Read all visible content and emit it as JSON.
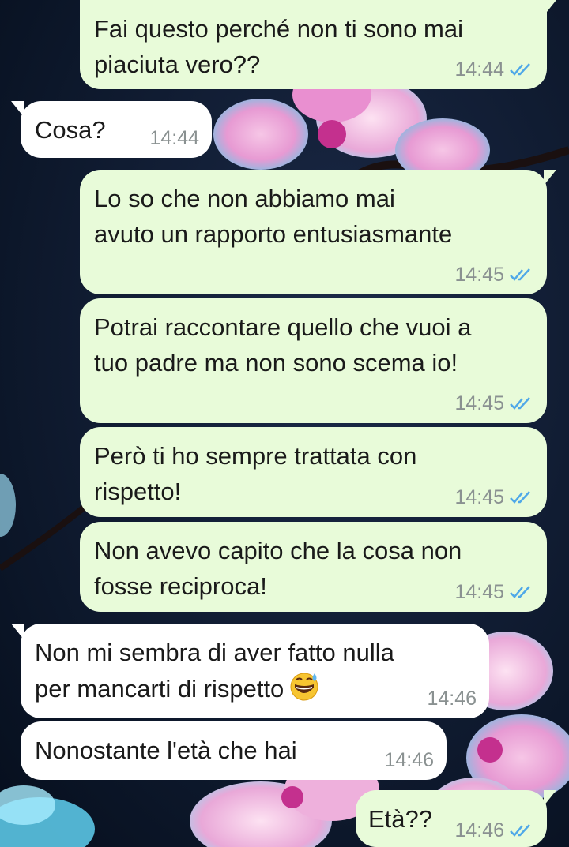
{
  "chat": {
    "messages": [
      {
        "dir": "out",
        "text": "Fai questo perché non ti sono mai\npiaciuta vero??",
        "time": "14:44",
        "read": true
      },
      {
        "dir": "in",
        "text": "Cosa?",
        "time": "14:44"
      },
      {
        "dir": "out",
        "text": "Lo so che non abbiamo mai\navuto un rapporto entusiasmante",
        "time": "14:45",
        "read": true
      },
      {
        "dir": "out",
        "text": "Potrai raccontare quello che vuoi a\ntuo padre ma non sono scema io!",
        "time": "14:45",
        "read": true
      },
      {
        "dir": "out",
        "text": "Però ti ho sempre trattata con\nrispetto!",
        "time": "14:45",
        "read": true
      },
      {
        "dir": "out",
        "text": "Non avevo capito che la cosa non\nfosse reciproca!",
        "time": "14:45",
        "read": true
      },
      {
        "dir": "in",
        "text": "Non mi sembra di aver fatto nulla\nper mancarti di rispetto",
        "time": "14:46",
        "emoji": "grinning-sweat-emoji"
      },
      {
        "dir": "in",
        "text": "Nonostante l'età che hai",
        "time": "14:46"
      },
      {
        "dir": "out",
        "text": "Età??",
        "time": "14:46",
        "read": true
      }
    ]
  },
  "colors": {
    "outgoing_bubble": "#e8fbd9",
    "incoming_bubble": "#ffffff",
    "read_ticks": "#4fa8e8",
    "timestamp": "#8a9191",
    "wallpaper": "#0a1526"
  }
}
